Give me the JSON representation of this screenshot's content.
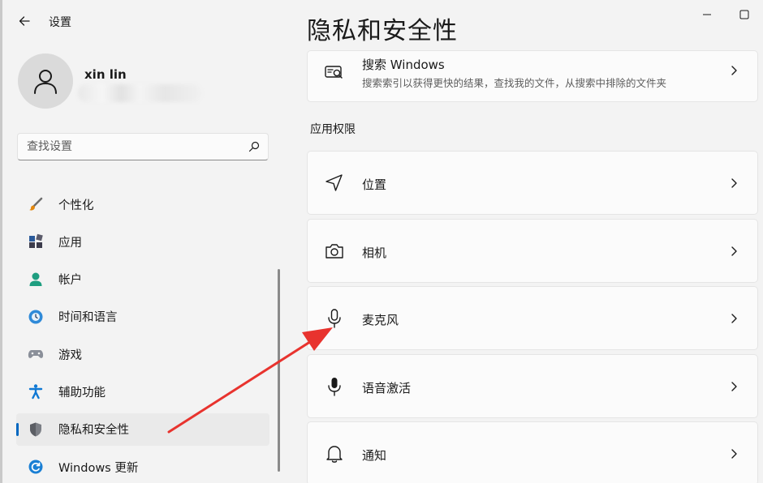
{
  "window": {
    "title": "设置",
    "back_icon": "back-arrow-icon",
    "controls": [
      "minimize-icon",
      "maximize-icon"
    ]
  },
  "profile": {
    "name": "xin lin",
    "avatar_icon": "person-icon"
  },
  "search": {
    "placeholder": "查找设置",
    "icon": "search-icon"
  },
  "sidebar": {
    "items": [
      {
        "label": "个性化",
        "icon": "brush-icon"
      },
      {
        "label": "应用",
        "icon": "apps-icon"
      },
      {
        "label": "帐户",
        "icon": "account-icon"
      },
      {
        "label": "时间和语言",
        "icon": "globe-clock-icon"
      },
      {
        "label": "游戏",
        "icon": "gamepad-icon"
      },
      {
        "label": "辅助功能",
        "icon": "accessibility-icon"
      },
      {
        "label": "隐私和安全性",
        "icon": "shield-icon",
        "active": true
      },
      {
        "label": "Windows 更新",
        "icon": "windows-update-icon"
      }
    ]
  },
  "main": {
    "title": "隐私和安全性",
    "search_card": {
      "title": "搜索 Windows",
      "subtitle": "搜索索引以获得更快的结果，查找我的文件，从搜索中排除的文件夹",
      "icon": "search-windows-icon"
    },
    "section_label": "应用权限",
    "permissions": [
      {
        "label": "位置",
        "icon": "location-icon"
      },
      {
        "label": "相机",
        "icon": "camera-icon"
      },
      {
        "label": "麦克风",
        "icon": "microphone-icon"
      },
      {
        "label": "语音激活",
        "icon": "voice-activation-icon"
      },
      {
        "label": "通知",
        "icon": "bell-icon"
      }
    ]
  },
  "colors": {
    "accent": "#0067c0",
    "annotation_arrow": "#e8332e",
    "background": "#f3f3f3",
    "card": "#fbfbfb"
  }
}
